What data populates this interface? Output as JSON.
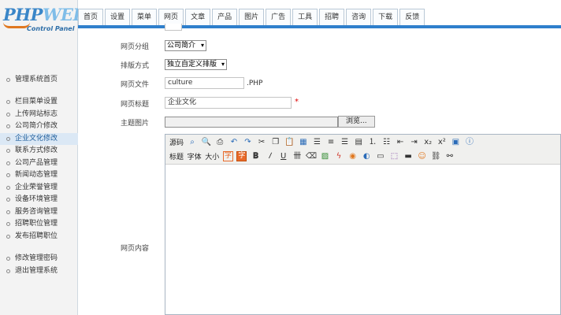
{
  "logo": {
    "brand_main": "PHP",
    "brand_accent": "WEB",
    "subtitle": "Control Panel"
  },
  "colors": {
    "accent_blue": "#2e7fcc",
    "required_red": "#dd0000",
    "logo_orange": "#e07820"
  },
  "sidebar": {
    "groups": [
      {
        "items": [
          {
            "label": "管理系统首页"
          }
        ]
      },
      {
        "items": [
          {
            "label": "栏目菜单设置"
          },
          {
            "label": "上传网站标志"
          },
          {
            "label": "公司简介修改"
          },
          {
            "label": "企业文化修改",
            "active": true
          },
          {
            "label": "联系方式修改"
          },
          {
            "label": "公司产品管理"
          },
          {
            "label": "新闻动态管理"
          },
          {
            "label": "企业荣誉管理"
          },
          {
            "label": "设备环境管理"
          },
          {
            "label": "服务咨询管理"
          },
          {
            "label": "招聘职位管理"
          },
          {
            "label": "发布招聘职位"
          }
        ]
      },
      {
        "items": [
          {
            "label": "修改管理密码"
          },
          {
            "label": "退出管理系统"
          }
        ]
      }
    ]
  },
  "nav": {
    "tabs": [
      {
        "label": "首页"
      },
      {
        "label": "设置"
      },
      {
        "label": "菜单"
      },
      {
        "label": "网页"
      },
      {
        "label": "文章"
      },
      {
        "label": "产品"
      },
      {
        "label": "图片"
      },
      {
        "label": "广告"
      },
      {
        "label": "工具"
      },
      {
        "label": "招聘"
      },
      {
        "label": "咨询"
      },
      {
        "label": "下载"
      },
      {
        "label": "反馈"
      }
    ]
  },
  "form": {
    "group_label": "网页分组",
    "group_value": "公司简介",
    "sort_label": "排版方式",
    "sort_value": "独立自定义排版",
    "file_label": "网页文件",
    "file_value": "culture",
    "file_ext": ".PHP",
    "title_label": "网页标题",
    "title_value": "企业文化",
    "required_mark": "*",
    "image_label": "主题图片",
    "image_value": "",
    "browse_label": "浏览...",
    "content_label": "网页内容"
  },
  "editor": {
    "row1": [
      {
        "type": "text",
        "label": "源码"
      },
      {
        "type": "icon",
        "name": "preview-icon"
      },
      {
        "type": "icon",
        "name": "find-icon"
      },
      {
        "type": "icon",
        "name": "print-icon"
      },
      {
        "type": "icon",
        "name": "undo-icon"
      },
      {
        "type": "icon",
        "name": "redo-icon"
      },
      {
        "type": "icon",
        "name": "cut-icon"
      },
      {
        "type": "icon",
        "name": "copy-icon"
      },
      {
        "type": "icon",
        "name": "paste-icon"
      },
      {
        "type": "icon",
        "name": "paste-plain-icon"
      },
      {
        "type": "icon",
        "name": "align-left-icon"
      },
      {
        "type": "icon",
        "name": "align-center-icon"
      },
      {
        "type": "icon",
        "name": "align-right-icon"
      },
      {
        "type": "icon",
        "name": "align-justify-icon"
      },
      {
        "type": "icon",
        "name": "ordered-list-icon"
      },
      {
        "type": "icon",
        "name": "unordered-list-icon"
      },
      {
        "type": "icon",
        "name": "outdent-icon"
      },
      {
        "type": "icon",
        "name": "indent-icon"
      },
      {
        "type": "icon",
        "name": "subscript-icon"
      },
      {
        "type": "icon",
        "name": "superscript-icon"
      },
      {
        "type": "icon",
        "name": "select-all-icon"
      },
      {
        "type": "icon",
        "name": "about-icon"
      }
    ],
    "row2": [
      {
        "type": "text",
        "label": "标题"
      },
      {
        "type": "text",
        "label": "字体"
      },
      {
        "type": "text",
        "label": "大小"
      },
      {
        "type": "boxtext",
        "label": "字",
        "style": "outline",
        "name": "text-color-icon"
      },
      {
        "type": "boxtext",
        "label": "字",
        "style": "fill",
        "name": "background-color-icon"
      },
      {
        "type": "icon",
        "name": "bold-icon"
      },
      {
        "type": "icon",
        "name": "italic-icon"
      },
      {
        "type": "icon",
        "name": "underline-icon"
      },
      {
        "type": "icon",
        "name": "strikethrough-icon"
      },
      {
        "type": "icon",
        "name": "remove-format-icon"
      },
      {
        "type": "icon",
        "name": "image-icon"
      },
      {
        "type": "icon",
        "name": "flash-icon"
      },
      {
        "type": "icon",
        "name": "media-icon"
      },
      {
        "type": "icon",
        "name": "emoticon-icon"
      },
      {
        "type": "icon",
        "name": "table-icon"
      },
      {
        "type": "icon",
        "name": "layer-icon"
      },
      {
        "type": "icon",
        "name": "hr-icon"
      },
      {
        "type": "icon",
        "name": "smiley-icon"
      },
      {
        "type": "icon",
        "name": "link-icon"
      },
      {
        "type": "icon",
        "name": "unlink-icon"
      }
    ]
  }
}
